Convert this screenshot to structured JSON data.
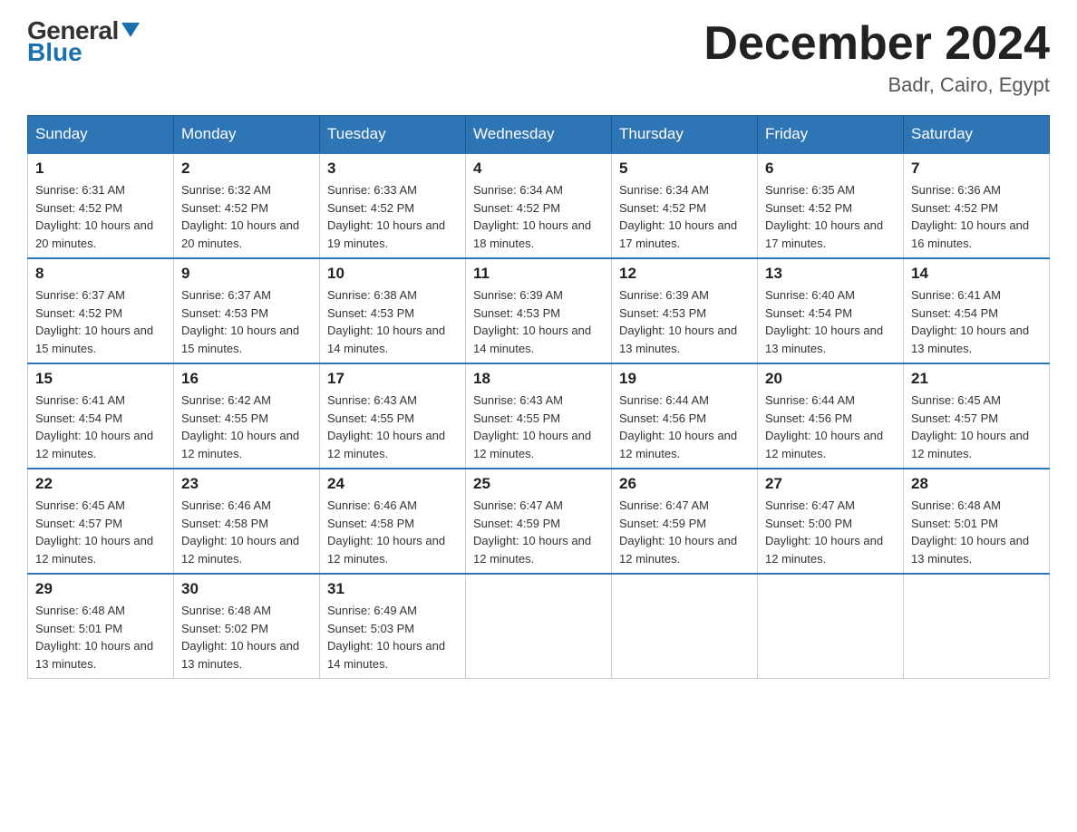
{
  "logo": {
    "line1": "General",
    "line2": "Blue"
  },
  "title": {
    "month_year": "December 2024",
    "location": "Badr, Cairo, Egypt"
  },
  "weekdays": [
    "Sunday",
    "Monday",
    "Tuesday",
    "Wednesday",
    "Thursday",
    "Friday",
    "Saturday"
  ],
  "weeks": [
    [
      {
        "day": "1",
        "sunrise": "6:31 AM",
        "sunset": "4:52 PM",
        "daylight": "10 hours and 20 minutes."
      },
      {
        "day": "2",
        "sunrise": "6:32 AM",
        "sunset": "4:52 PM",
        "daylight": "10 hours and 20 minutes."
      },
      {
        "day": "3",
        "sunrise": "6:33 AM",
        "sunset": "4:52 PM",
        "daylight": "10 hours and 19 minutes."
      },
      {
        "day": "4",
        "sunrise": "6:34 AM",
        "sunset": "4:52 PM",
        "daylight": "10 hours and 18 minutes."
      },
      {
        "day": "5",
        "sunrise": "6:34 AM",
        "sunset": "4:52 PM",
        "daylight": "10 hours and 17 minutes."
      },
      {
        "day": "6",
        "sunrise": "6:35 AM",
        "sunset": "4:52 PM",
        "daylight": "10 hours and 17 minutes."
      },
      {
        "day": "7",
        "sunrise": "6:36 AM",
        "sunset": "4:52 PM",
        "daylight": "10 hours and 16 minutes."
      }
    ],
    [
      {
        "day": "8",
        "sunrise": "6:37 AM",
        "sunset": "4:52 PM",
        "daylight": "10 hours and 15 minutes."
      },
      {
        "day": "9",
        "sunrise": "6:37 AM",
        "sunset": "4:53 PM",
        "daylight": "10 hours and 15 minutes."
      },
      {
        "day": "10",
        "sunrise": "6:38 AM",
        "sunset": "4:53 PM",
        "daylight": "10 hours and 14 minutes."
      },
      {
        "day": "11",
        "sunrise": "6:39 AM",
        "sunset": "4:53 PM",
        "daylight": "10 hours and 14 minutes."
      },
      {
        "day": "12",
        "sunrise": "6:39 AM",
        "sunset": "4:53 PM",
        "daylight": "10 hours and 13 minutes."
      },
      {
        "day": "13",
        "sunrise": "6:40 AM",
        "sunset": "4:54 PM",
        "daylight": "10 hours and 13 minutes."
      },
      {
        "day": "14",
        "sunrise": "6:41 AM",
        "sunset": "4:54 PM",
        "daylight": "10 hours and 13 minutes."
      }
    ],
    [
      {
        "day": "15",
        "sunrise": "6:41 AM",
        "sunset": "4:54 PM",
        "daylight": "10 hours and 12 minutes."
      },
      {
        "day": "16",
        "sunrise": "6:42 AM",
        "sunset": "4:55 PM",
        "daylight": "10 hours and 12 minutes."
      },
      {
        "day": "17",
        "sunrise": "6:43 AM",
        "sunset": "4:55 PM",
        "daylight": "10 hours and 12 minutes."
      },
      {
        "day": "18",
        "sunrise": "6:43 AM",
        "sunset": "4:55 PM",
        "daylight": "10 hours and 12 minutes."
      },
      {
        "day": "19",
        "sunrise": "6:44 AM",
        "sunset": "4:56 PM",
        "daylight": "10 hours and 12 minutes."
      },
      {
        "day": "20",
        "sunrise": "6:44 AM",
        "sunset": "4:56 PM",
        "daylight": "10 hours and 12 minutes."
      },
      {
        "day": "21",
        "sunrise": "6:45 AM",
        "sunset": "4:57 PM",
        "daylight": "10 hours and 12 minutes."
      }
    ],
    [
      {
        "day": "22",
        "sunrise": "6:45 AM",
        "sunset": "4:57 PM",
        "daylight": "10 hours and 12 minutes."
      },
      {
        "day": "23",
        "sunrise": "6:46 AM",
        "sunset": "4:58 PM",
        "daylight": "10 hours and 12 minutes."
      },
      {
        "day": "24",
        "sunrise": "6:46 AM",
        "sunset": "4:58 PM",
        "daylight": "10 hours and 12 minutes."
      },
      {
        "day": "25",
        "sunrise": "6:47 AM",
        "sunset": "4:59 PM",
        "daylight": "10 hours and 12 minutes."
      },
      {
        "day": "26",
        "sunrise": "6:47 AM",
        "sunset": "4:59 PM",
        "daylight": "10 hours and 12 minutes."
      },
      {
        "day": "27",
        "sunrise": "6:47 AM",
        "sunset": "5:00 PM",
        "daylight": "10 hours and 12 minutes."
      },
      {
        "day": "28",
        "sunrise": "6:48 AM",
        "sunset": "5:01 PM",
        "daylight": "10 hours and 13 minutes."
      }
    ],
    [
      {
        "day": "29",
        "sunrise": "6:48 AM",
        "sunset": "5:01 PM",
        "daylight": "10 hours and 13 minutes."
      },
      {
        "day": "30",
        "sunrise": "6:48 AM",
        "sunset": "5:02 PM",
        "daylight": "10 hours and 13 minutes."
      },
      {
        "day": "31",
        "sunrise": "6:49 AM",
        "sunset": "5:03 PM",
        "daylight": "10 hours and 14 minutes."
      },
      null,
      null,
      null,
      null
    ]
  ]
}
